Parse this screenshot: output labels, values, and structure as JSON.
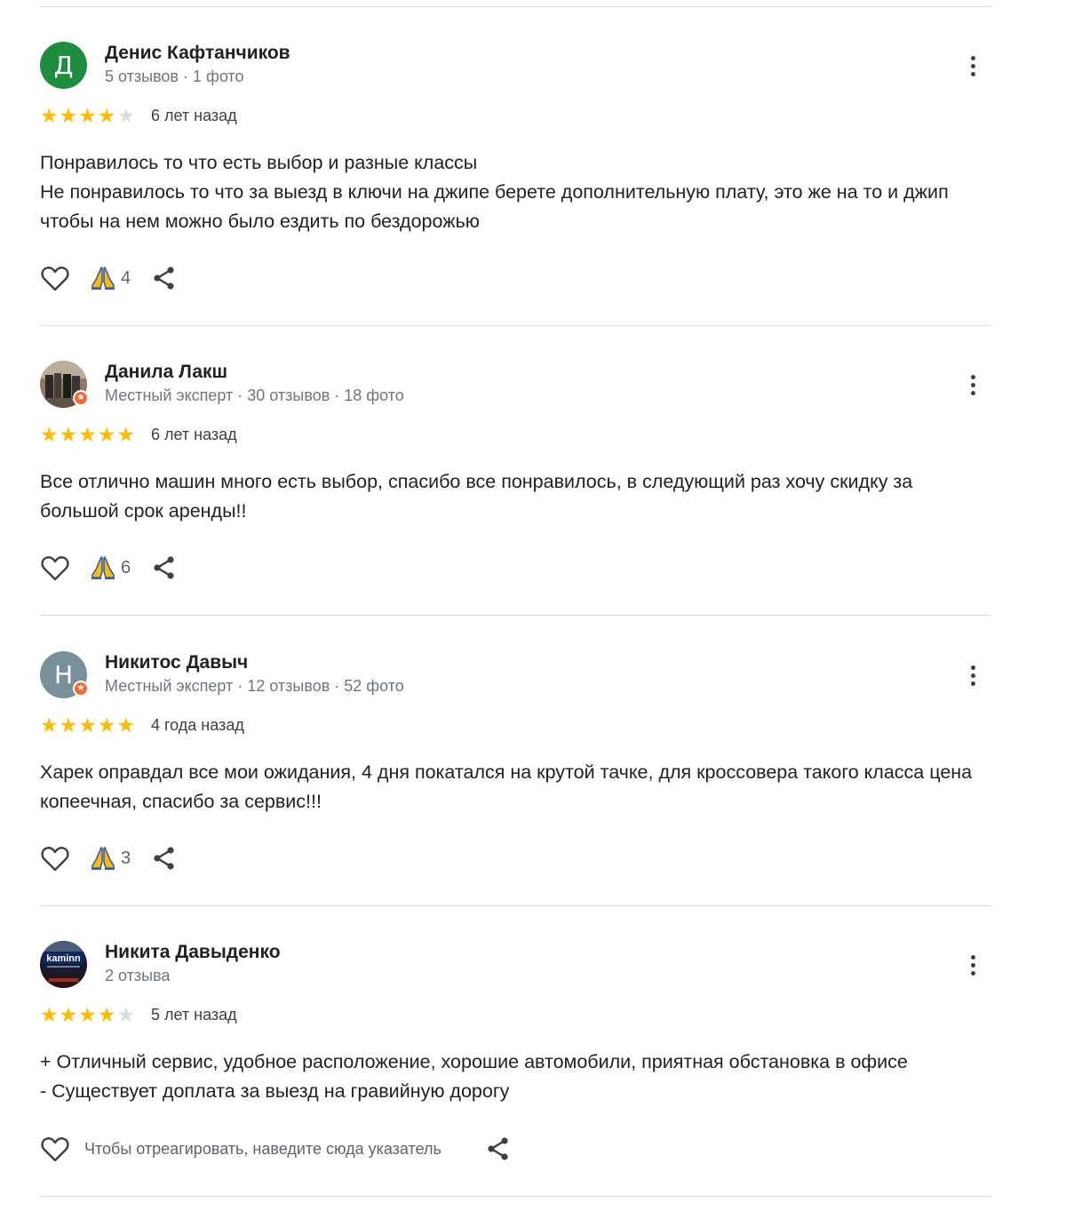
{
  "reviews": [
    {
      "name": "Денис Кафтанчиков",
      "meta": "5 отзывов · 1 фото",
      "avatar_letter": "Д",
      "avatar_color": "#1e8e3e",
      "rating": 4,
      "date": "6 лет назад",
      "lines": [
        "Понравилось то что есть выбор и разные классы",
        "Не понравилось то что за выезд в ключи на джипе берете дополнительную плату, это же на то и джип чтобы на нем можно было ездить по бездорожью"
      ],
      "reaction_count": "4",
      "local_guide": false
    },
    {
      "name": "Данила Лакш",
      "meta": "Местный эксперт · 30 отзывов · 18 фото",
      "avatar_letter": "",
      "avatar_color": "#6b5a4a",
      "rating": 5,
      "date": "6 лет назад",
      "lines": [
        "Все отлично машин много есть выбор, спасибо все понравилось, в следующий раз хочу скидку за большой срок аренды!!"
      ],
      "reaction_count": "6",
      "local_guide": true
    },
    {
      "name": "Никитос Давыч",
      "meta": "Местный эксперт · 12 отзывов · 52 фото",
      "avatar_letter": "Н",
      "avatar_color": "#78909c",
      "rating": 5,
      "date": "4 года назад",
      "lines": [
        "Харек оправдал все мои ожидания, 4 дня покатался на крутой тачке, для кроссовера такого класса цена копеечная, спасибо за сервис!!!"
      ],
      "reaction_count": "3",
      "local_guide": true
    },
    {
      "name": "Никита Давыденко",
      "meta": "2 отзыва",
      "avatar_letter": "",
      "avatar_color": "#1a1a2e",
      "avatar_logo_text": "kaminn",
      "rating": 4,
      "date": "5 лет назад",
      "lines": [
        "+ Отличный сервис, удобное расположение, хорошие автомобили, приятная обстановка в офисе",
        "- Существует доплата за выезд на гравийную дорогу"
      ],
      "reaction_hint": "Чтобы отреагировать, наведите сюда указатель",
      "local_guide": false
    }
  ],
  "colors": {
    "star_filled": "#fbbc04",
    "star_empty": "#dadce0",
    "divider": "#dadce0",
    "local_guide_badge": "#f26b3a"
  },
  "icons": [
    "heart-icon",
    "praying-hands-icon",
    "share-icon",
    "more-vert-icon",
    "star-icon",
    "local-guide-badge-icon"
  ]
}
